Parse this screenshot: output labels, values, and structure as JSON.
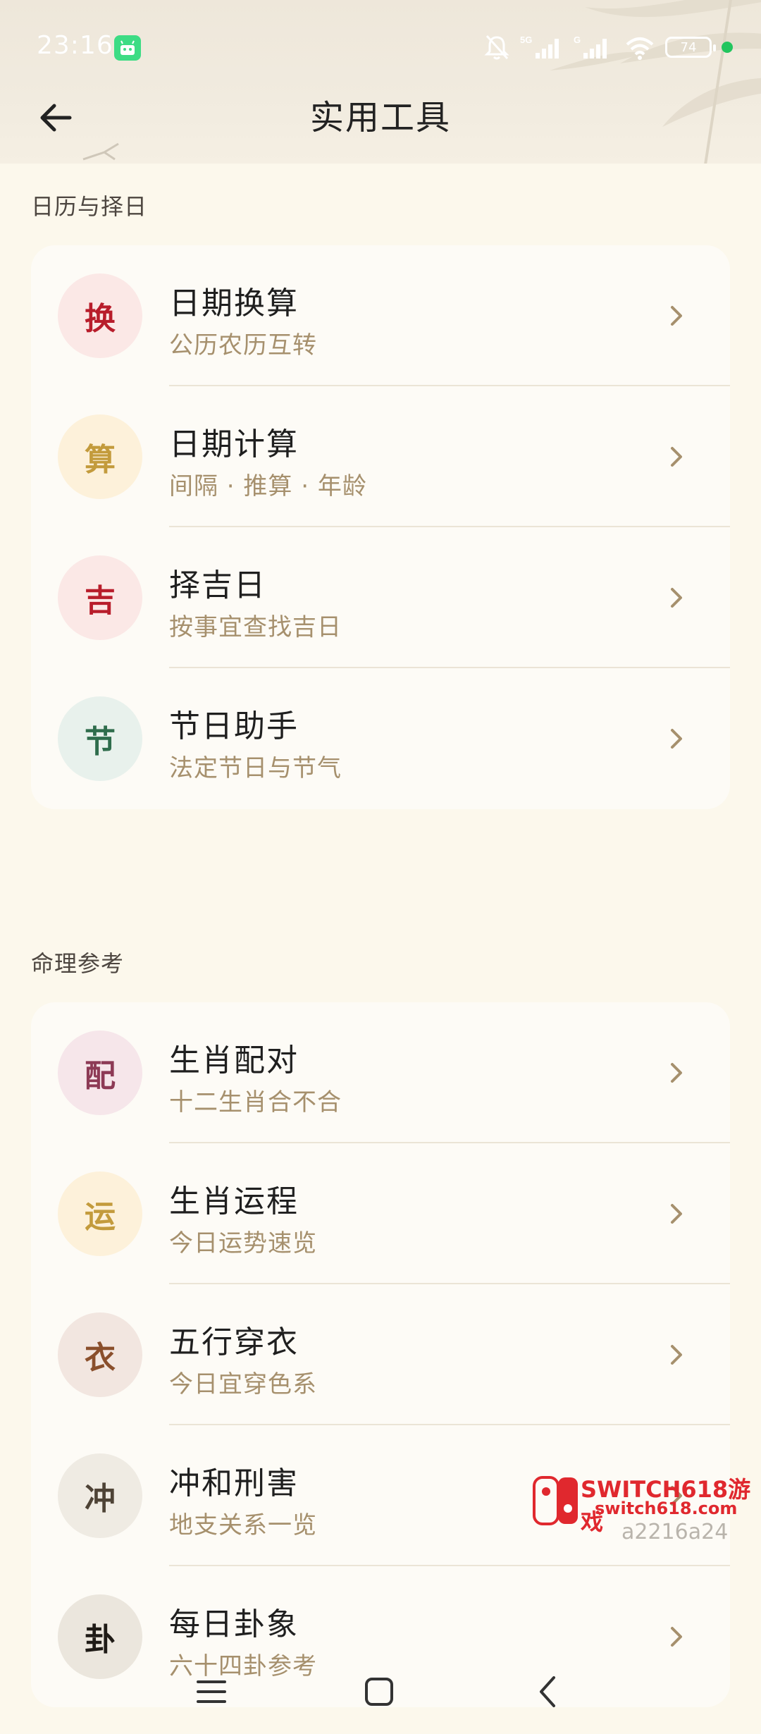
{
  "status_bar": {
    "time": "23:16",
    "battery_level": "74",
    "network_labels": [
      "5G",
      "G"
    ],
    "icons": [
      "android-app-icon",
      "mute-bell-icon",
      "signal-5g-icon",
      "signal-g-icon",
      "wifi-icon",
      "battery-icon",
      "charging-dot-icon"
    ]
  },
  "header": {
    "title": "实用工具",
    "back_icon": "arrow-left-icon"
  },
  "sections": [
    {
      "title": "日历与择日",
      "items": [
        {
          "badge": "换",
          "title": "日期换算",
          "subtitle": "公历农历互转",
          "badge_color": "#b81d2b",
          "badge_bg": "#fbe8e6"
        },
        {
          "badge": "算",
          "title": "日期计算",
          "subtitle": "间隔 · 推算 · 年龄",
          "badge_color": "#c39b3c",
          "badge_bg": "#fdf1da"
        },
        {
          "badge": "吉",
          "title": "择吉日",
          "subtitle": "按事宜查找吉日",
          "badge_color": "#b81d2b",
          "badge_bg": "#fbe8e6"
        },
        {
          "badge": "节",
          "title": "节日助手",
          "subtitle": "法定节日与节气",
          "badge_color": "#2f6d4c",
          "badge_bg": "#e8f1ec"
        }
      ]
    },
    {
      "title": "命理参考",
      "items": [
        {
          "badge": "配",
          "title": "生肖配对",
          "subtitle": "十二生肖合不合",
          "badge_color": "#8d3a55",
          "badge_bg": "#f6e6ea"
        },
        {
          "badge": "运",
          "title": "生肖运程",
          "subtitle": "今日运势速览",
          "badge_color": "#c39b3c",
          "badge_bg": "#fdf1da"
        },
        {
          "badge": "衣",
          "title": "五行穿衣",
          "subtitle": "今日宜穿色系",
          "badge_color": "#8a4f2c",
          "badge_bg": "#f2e6e0"
        },
        {
          "badge": "冲",
          "title": "冲和刑害",
          "subtitle": "地支关系一览",
          "badge_color": "#4e4336",
          "badge_bg": "#efebe3"
        },
        {
          "badge": "卦",
          "title": "每日卦象",
          "subtitle": "六十四卦参考",
          "badge_color": "#1f1b16",
          "badge_bg": "#ebe6dd"
        }
      ]
    }
  ],
  "nav_bar": {
    "icons": [
      "menu-icon",
      "home-square-icon",
      "back-chevron-icon"
    ]
  },
  "watermark": {
    "brand": "SWITCH618游戏",
    "url": "switch618.com",
    "code": "a2216a24"
  },
  "colors": {
    "background": "#fcf8ec",
    "card": "#fdfbf6",
    "subtitle": "#a6906d",
    "chevron": "#a6906d"
  }
}
